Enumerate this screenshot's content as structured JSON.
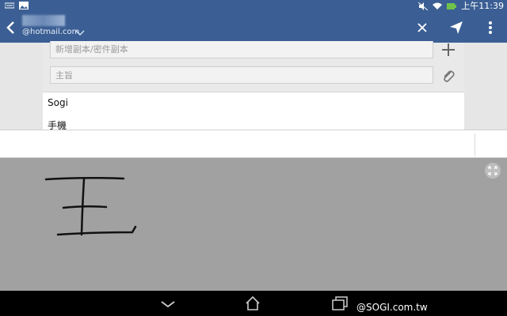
{
  "status_bar": {
    "time": "上午11:39",
    "icons": [
      "keyboard-icon",
      "image-icon",
      "mute-icon",
      "wifi-icon",
      "battery-icon"
    ]
  },
  "header": {
    "account_email": "@hotmail.com",
    "actions": [
      "close-icon",
      "send-icon",
      "overflow-menu-icon"
    ]
  },
  "compose": {
    "cc_placeholder": "新增副本/密件副本",
    "subject_placeholder": "主旨",
    "body_lines": [
      "Sogi",
      "手機"
    ]
  },
  "handwriting": {
    "recognized_glyph": "王"
  },
  "nav": {
    "buttons": [
      "back-icon",
      "home-icon",
      "recents-icon"
    ],
    "watermark": "@SOGI.com.tw"
  },
  "colors": {
    "header": "#3b5f94",
    "pad": "#a1a1a1",
    "nav": "#000000"
  }
}
